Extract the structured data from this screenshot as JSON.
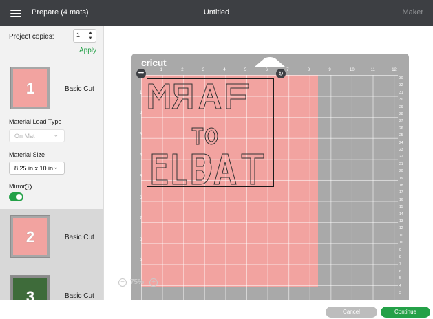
{
  "topbar": {
    "left_title": "Prepare (4 mats)",
    "center_title": "Untitled",
    "right_title": "Maker"
  },
  "sidebar": {
    "copies_label": "Project copies:",
    "copies_value": "1",
    "apply_label": "Apply",
    "mats": [
      {
        "number": "1",
        "label": "Basic Cut"
      },
      {
        "number": "2",
        "label": "Basic Cut"
      },
      {
        "number": "3",
        "label": "Basic Cut"
      }
    ],
    "material_load_type_label": "Material Load Type",
    "material_load_type_value": "On Mat",
    "material_size_label": "Material Size",
    "material_size_value": "8.25 in x 10 in",
    "mirror_label": "Mirror",
    "mirror_on": true
  },
  "canvas": {
    "brand": "cricut",
    "ruler_top": [
      "1",
      "2",
      "3",
      "4",
      "5",
      "6",
      "7",
      "8",
      "9",
      "10",
      "11",
      "12"
    ],
    "ruler_left": [
      "1",
      "2",
      "3",
      "4",
      "5",
      "6",
      "7",
      "8",
      "9"
    ],
    "ruler_right": [
      "30",
      "32",
      "31",
      "30",
      "29",
      "28",
      "27",
      "26",
      "25",
      "24",
      "23",
      "22",
      "21",
      "20",
      "19",
      "18",
      "17",
      "16",
      "15",
      "14",
      "13",
      "12",
      "11",
      "10",
      "9",
      "8",
      "7",
      "6",
      "5",
      "4",
      "3"
    ],
    "zoom": "75%",
    "sheet_color": "#f2a3a0"
  },
  "buttons": {
    "cancel": "Cancel",
    "continue": "Continue"
  },
  "colors": {
    "accent": "#24a148",
    "topbar": "#3d3f43"
  }
}
